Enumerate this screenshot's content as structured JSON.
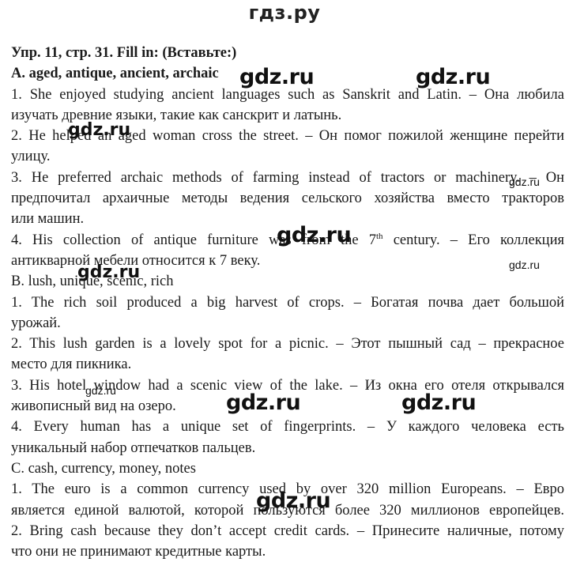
{
  "site_title": "гдз.ру",
  "exercise": {
    "heading": "Упр. 11, стр. 31. Fill in: (Вставьте:)",
    "sections": [
      {
        "header": "A. aged, antique, ancient, archaic",
        "items": [
          {
            "line1": "1. She enjoyed studying ancient languages such as Sanskrit and Latin. – Она любила",
            "line2": "изучать древние языки, такие как санскрит и латынь."
          },
          {
            "line1": "2. He helped an aged woman cross the street. – Он помог пожилой женщине перейти",
            "line2": "улицу."
          },
          {
            "line1": "3. He preferred archaic methods of farming instead of tractors or machinery. – Он",
            "line2": "предпочитал архаичные методы ведения сельского хозяйства вместо тракторов",
            "line3": "или машин."
          },
          {
            "line1_pre": "4. His collection of antique furniture was from the 7",
            "line1_sup": "th",
            "line1_post": " century. – Его коллекция",
            "line2": "антикварной мебели относится к 7 веку."
          }
        ]
      },
      {
        "header": "B. lush, unique, scenic, rich",
        "items": [
          {
            "line1": "1. The rich soil produced a big harvest of crops. – Богатая почва дает большой",
            "line2": "урожай."
          },
          {
            "line1": "2. This lush garden is a lovely spot for a picnic. – Этот пышный сад – прекрасное",
            "line2": "место для пикника."
          },
          {
            "line1": "3. His hotel window had a scenic view of the lake. – Из окна его отеля открывался",
            "line2": "живописный вид на озеро."
          },
          {
            "line1": "4. Every human has a unique set of fingerprints. – У каждого человека есть",
            "line2": "уникальный набор отпечатков пальцев."
          }
        ]
      },
      {
        "header": "C. cash, currency, money, notes",
        "items": [
          {
            "line1": "1. The euro is a common currency used by over 320 million Europeans. – Евро",
            "line2": "является единой валютой, которой пользуются более 320 миллионов европейцев."
          },
          {
            "line1": "2. Bring cash because they don’t accept credit cards. – Принесите наличные, потому",
            "line2": "что они не принимают кредитные карты."
          }
        ]
      }
    ]
  },
  "watermarks": {
    "text": "gdz.ru"
  }
}
